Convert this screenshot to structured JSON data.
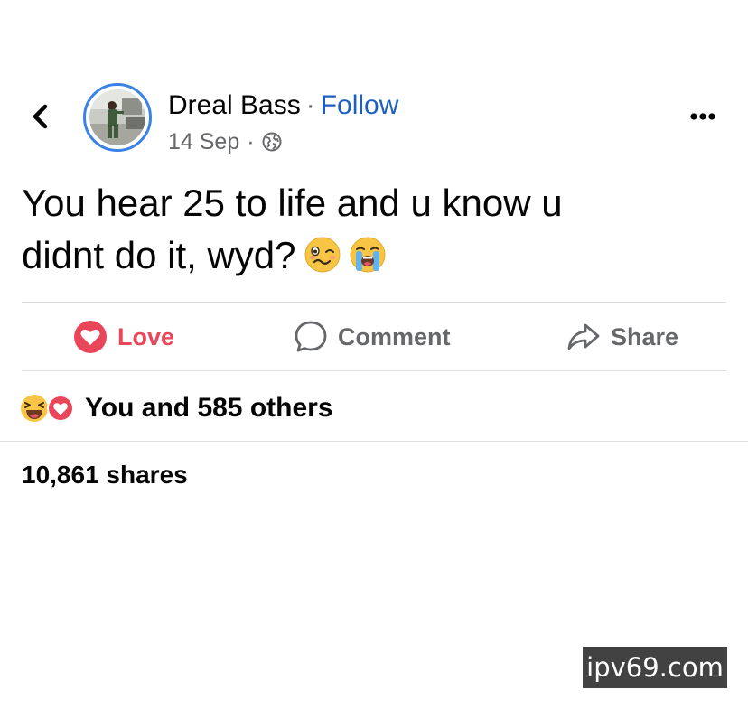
{
  "post": {
    "author": "Dreal Bass",
    "separator": "·",
    "follow_label": "Follow",
    "date": "14 Sep",
    "meta_separator": "·",
    "text_line1": "You hear 25 to life and u know u",
    "text_line2": "didnt do it, wyd?"
  },
  "icons": {
    "back": "chevron-left-icon",
    "more": "more-horizontal-icon",
    "privacy": "globe-icon",
    "emoji1": "woozy-face-emoji",
    "emoji2": "loudly-crying-face-emoji"
  },
  "actions": {
    "love_label": "Love",
    "comment_label": "Comment",
    "share_label": "Share"
  },
  "engagement": {
    "reactions_text": "You and 585 others",
    "shares_text": "10,861 shares"
  },
  "watermark": "ipv69.com",
  "colors": {
    "follow": "#1b5fc1",
    "love": "#e9465a",
    "muted": "#65676b",
    "avatar_ring": "#3b82e6"
  }
}
